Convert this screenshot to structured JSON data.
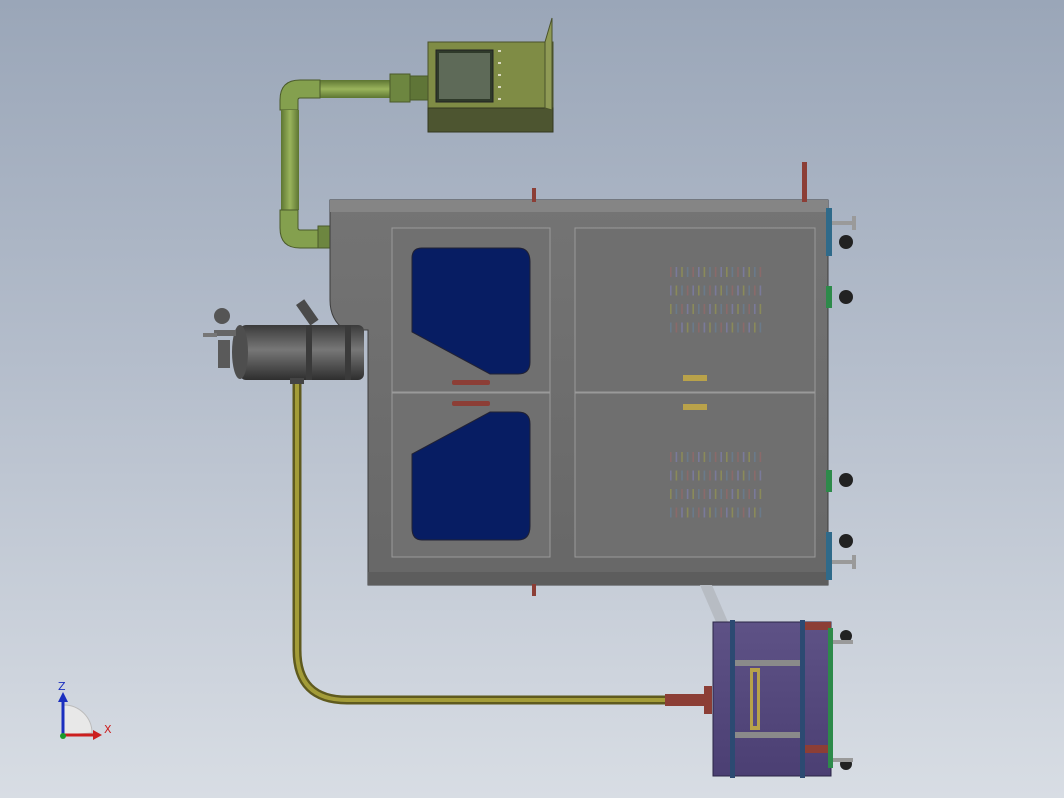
{
  "scene": {
    "description_free": true,
    "colors": {
      "background_top": "#9aa6b8",
      "background_bottom": "#d8dde4",
      "main_body": "#6e6e6e",
      "window_panel": "#071d63",
      "control_box": "#7d8a43",
      "pipe_green": "#7e9a4a",
      "pipe_olive": "#8a8a2e",
      "base_unit": "#5a4c82",
      "valve_teal": "#2f7a80"
    }
  },
  "triad": {
    "z_label": "Z",
    "x_label": "X",
    "z_color": "#1b2fbf",
    "x_color": "#cc1f1f",
    "y_color": "#1a9a2a"
  }
}
